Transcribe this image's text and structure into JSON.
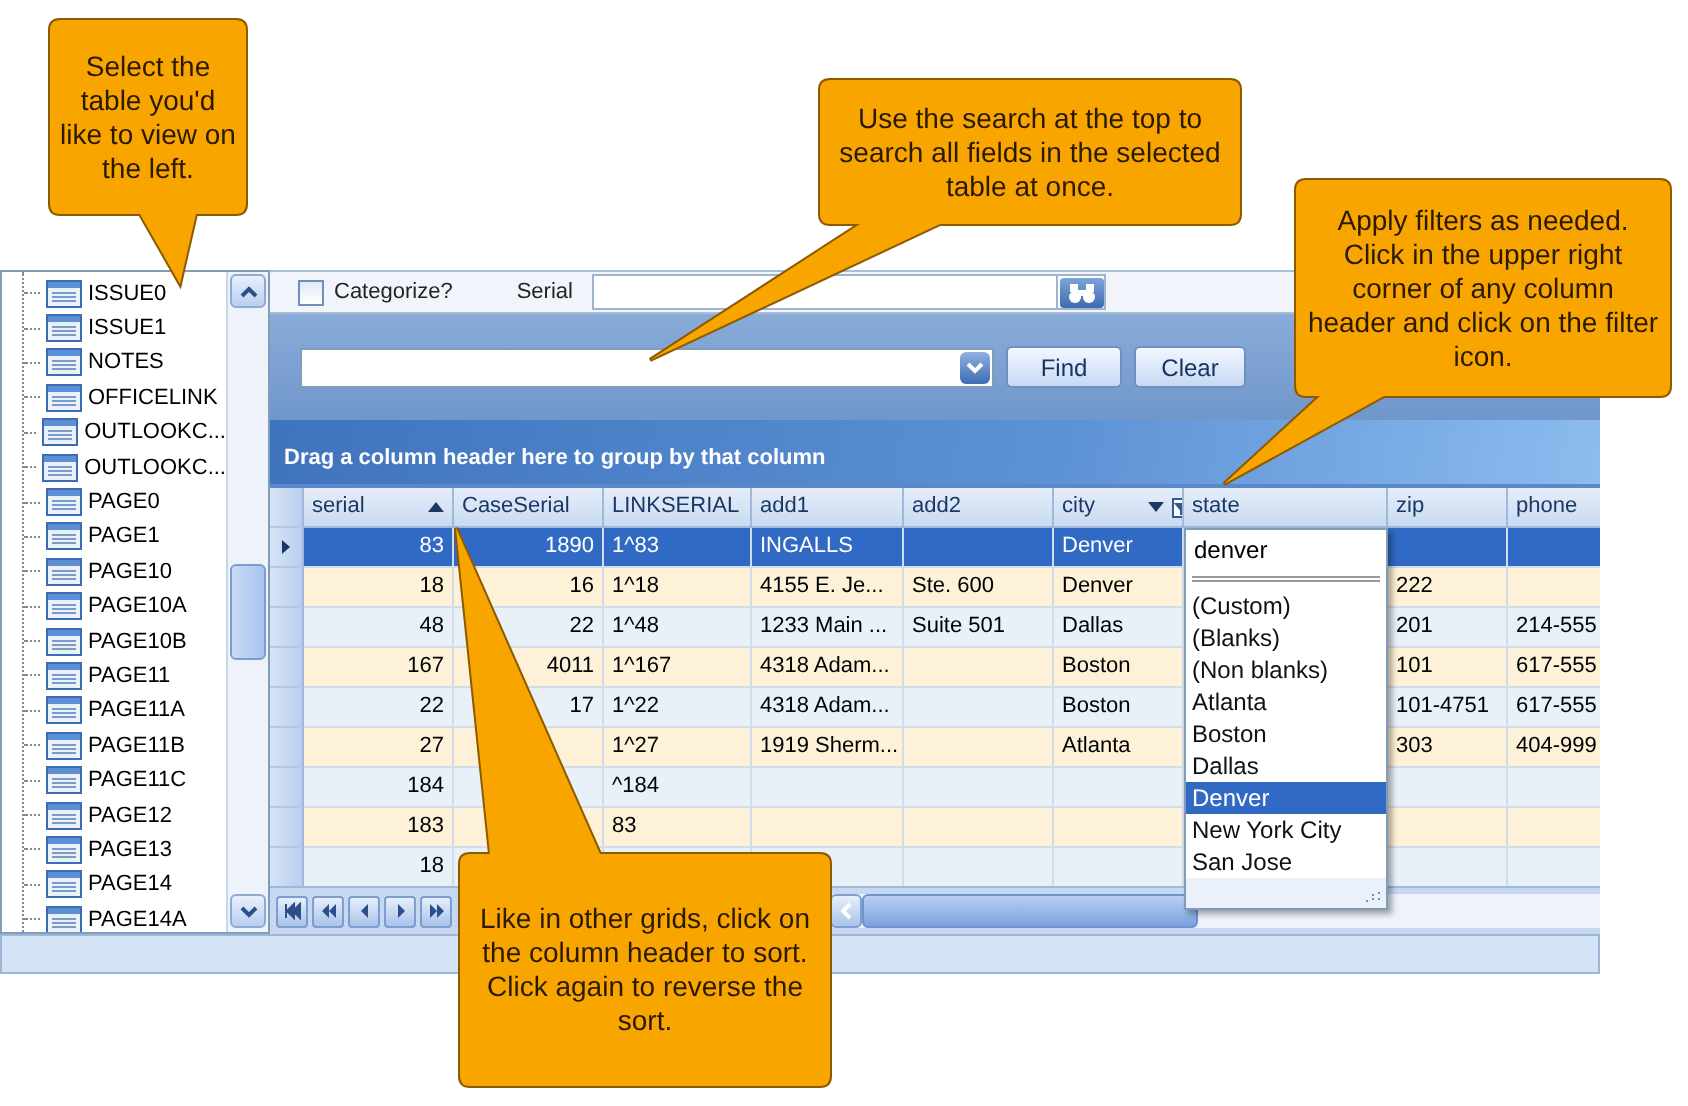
{
  "callouts": [
    {
      "text": "Select the table you'd like to view on the left."
    },
    {
      "text": "Use the search at the top to search all fields in the selected table at once."
    },
    {
      "text": "Apply filters as needed. Click in the upper right corner of any column header and click on the filter icon."
    },
    {
      "text": "Like in other grids, click on the column header to sort. Click again to reverse the sort."
    }
  ],
  "tables": {
    "items": [
      "ISSUE0",
      "ISSUE1",
      "NOTES",
      "OFFICELINK",
      "OUTLOOKC...",
      "OUTLOOKC...",
      "PAGE0",
      "PAGE1",
      "PAGE10",
      "PAGE10A",
      "PAGE10B",
      "PAGE11",
      "PAGE11A",
      "PAGE11B",
      "PAGE11C",
      "PAGE12",
      "PAGE13",
      "PAGE14",
      "PAGE14A"
    ]
  },
  "toolbar": {
    "categorize": {
      "label": "Categorize?",
      "checked": false
    },
    "serial_label": "Serial"
  },
  "search": {
    "find": "Find",
    "clear": "Clear"
  },
  "group_panel": {
    "text": "Drag a column header here to group by that column"
  },
  "grid": {
    "columns": [
      {
        "label": "serial",
        "numeric": true,
        "sorted_ascending": true
      },
      {
        "label": "CaseSerial",
        "numeric": true
      },
      {
        "label": "LINKSERIAL"
      },
      {
        "label": "add1"
      },
      {
        "label": "add2"
      },
      {
        "label": "city",
        "filter": true
      },
      {
        "label": "state"
      },
      {
        "label": "zip"
      },
      {
        "label": "phone"
      }
    ],
    "rows": [
      {
        "selected": true,
        "cells": [
          "83",
          "1890",
          "1^83",
          "INGALLS",
          null,
          "Denver",
          null,
          null,
          null
        ]
      },
      {
        "selected": false,
        "cells": [
          "18",
          "16",
          "1^18",
          "4155 E. Je...",
          "Ste. 600",
          "Denver",
          null,
          "222",
          null
        ]
      },
      {
        "selected": false,
        "cells": [
          "48",
          "22",
          "1^48",
          "1233 Main ...",
          "Suite 501",
          "Dallas",
          null,
          "201",
          "214-555"
        ]
      },
      {
        "selected": false,
        "cells": [
          "167",
          "4011",
          "1^167",
          "4318 Adam...",
          null,
          "Boston",
          null,
          "101",
          "617-555"
        ]
      },
      {
        "selected": false,
        "cells": [
          "22",
          "17",
          "1^22",
          "4318 Adam...",
          null,
          "Boston",
          null,
          "101-4751",
          "617-555"
        ]
      },
      {
        "selected": false,
        "cells": [
          "27",
          null,
          "1^27",
          "1919 Sherm...",
          null,
          "Atlanta",
          null,
          "303",
          "404-999"
        ]
      },
      {
        "selected": false,
        "cells": [
          "184",
          null,
          "^184",
          null,
          null,
          null,
          null,
          null,
          null
        ]
      },
      {
        "selected": false,
        "cells": [
          "183",
          null,
          "83",
          null,
          null,
          null,
          null,
          null,
          null
        ]
      },
      {
        "selected": false,
        "cells": [
          "18",
          null,
          null,
          null,
          null,
          null,
          null,
          null,
          null
        ]
      }
    ]
  },
  "filter_dropdown": {
    "value": "denver",
    "options": [
      {
        "label": "(Custom)",
        "selected": false
      },
      {
        "label": "(Blanks)",
        "selected": false
      },
      {
        "label": "(Non blanks)",
        "selected": false
      },
      {
        "label": "Atlanta",
        "selected": false
      },
      {
        "label": "Boston",
        "selected": false
      },
      {
        "label": "Dallas",
        "selected": false
      },
      {
        "label": "Denver",
        "selected": true
      },
      {
        "label": "New York City",
        "selected": false
      },
      {
        "label": "San Jose",
        "selected": false
      }
    ]
  }
}
